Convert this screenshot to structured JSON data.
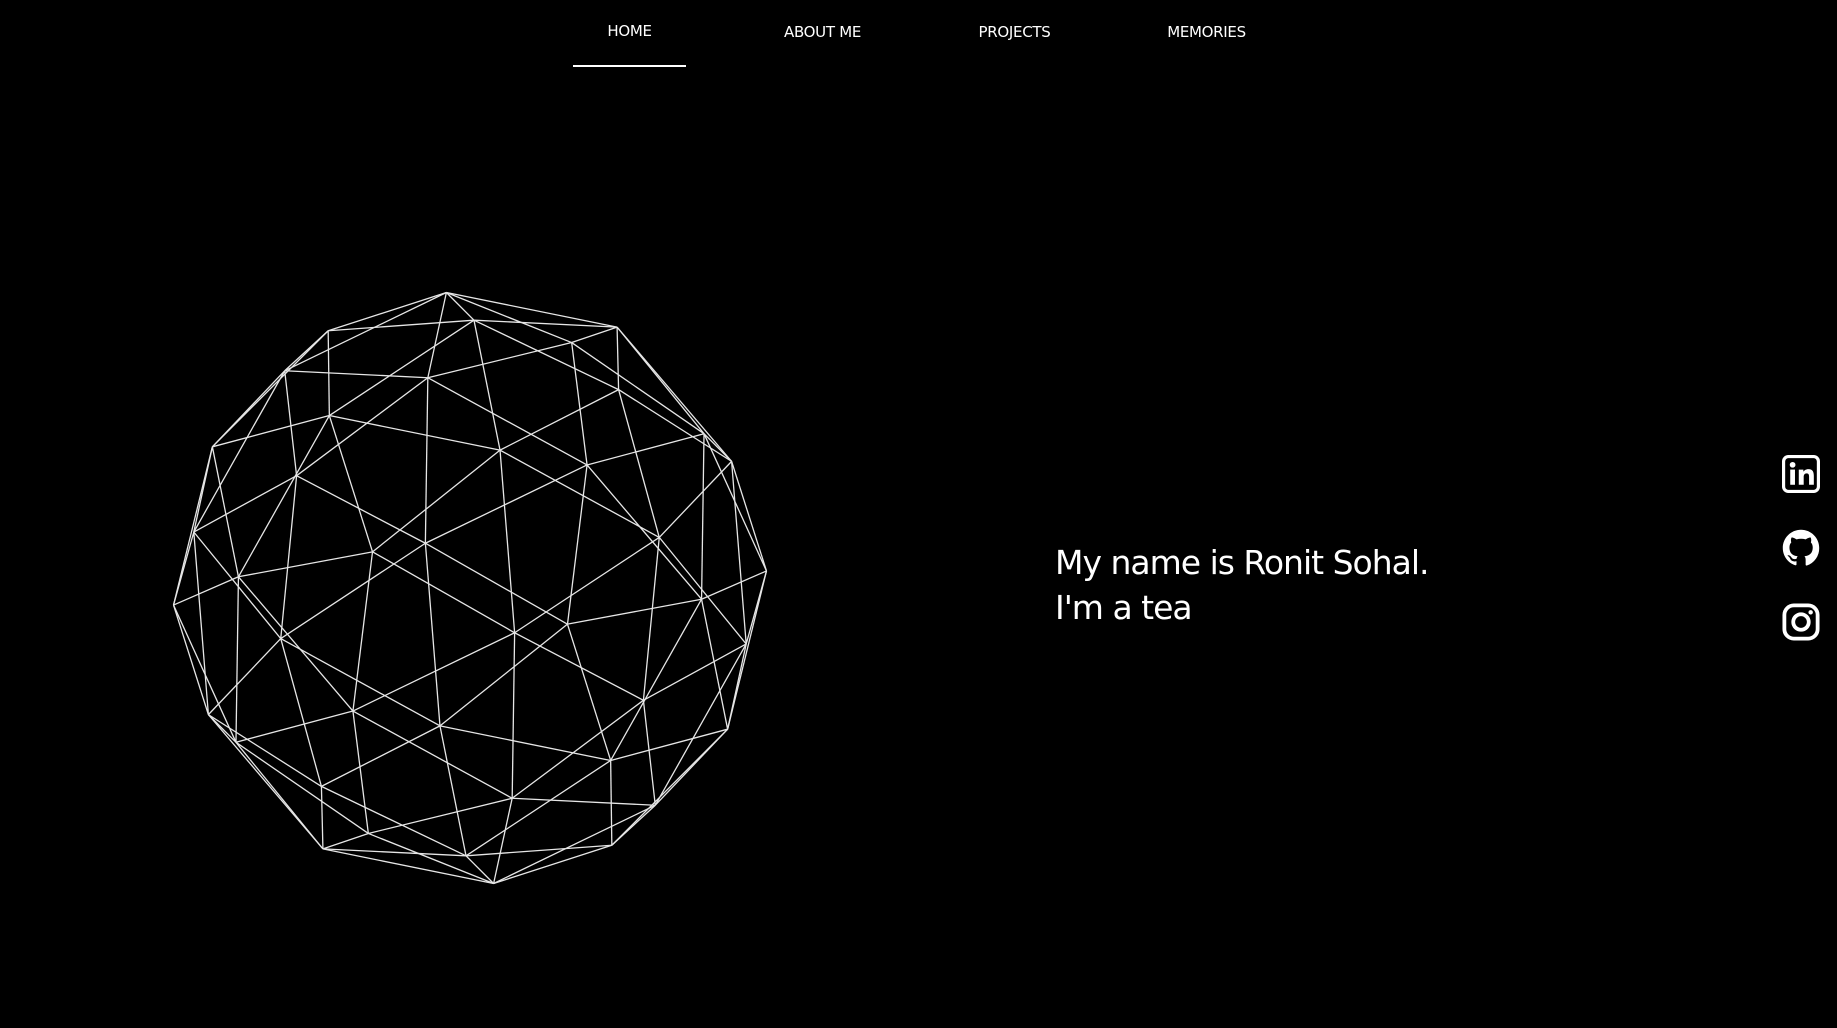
{
  "nav": {
    "items": [
      {
        "label": "HOME",
        "active": true
      },
      {
        "label": "ABOUT ME",
        "active": false
      },
      {
        "label": "PROJECTS",
        "active": false
      },
      {
        "label": "MEMORIES",
        "active": false
      }
    ]
  },
  "hero": {
    "intro_line1": "My name is Ronit Sohal.",
    "intro_line2": "I'm a tea"
  },
  "socials": [
    {
      "icon": "linkedin-icon"
    },
    {
      "icon": "github-icon"
    },
    {
      "icon": "instagram-icon"
    }
  ],
  "colors": {
    "background": "#000000",
    "foreground": "#ffffff",
    "wireframe": "#e6e6e6"
  }
}
